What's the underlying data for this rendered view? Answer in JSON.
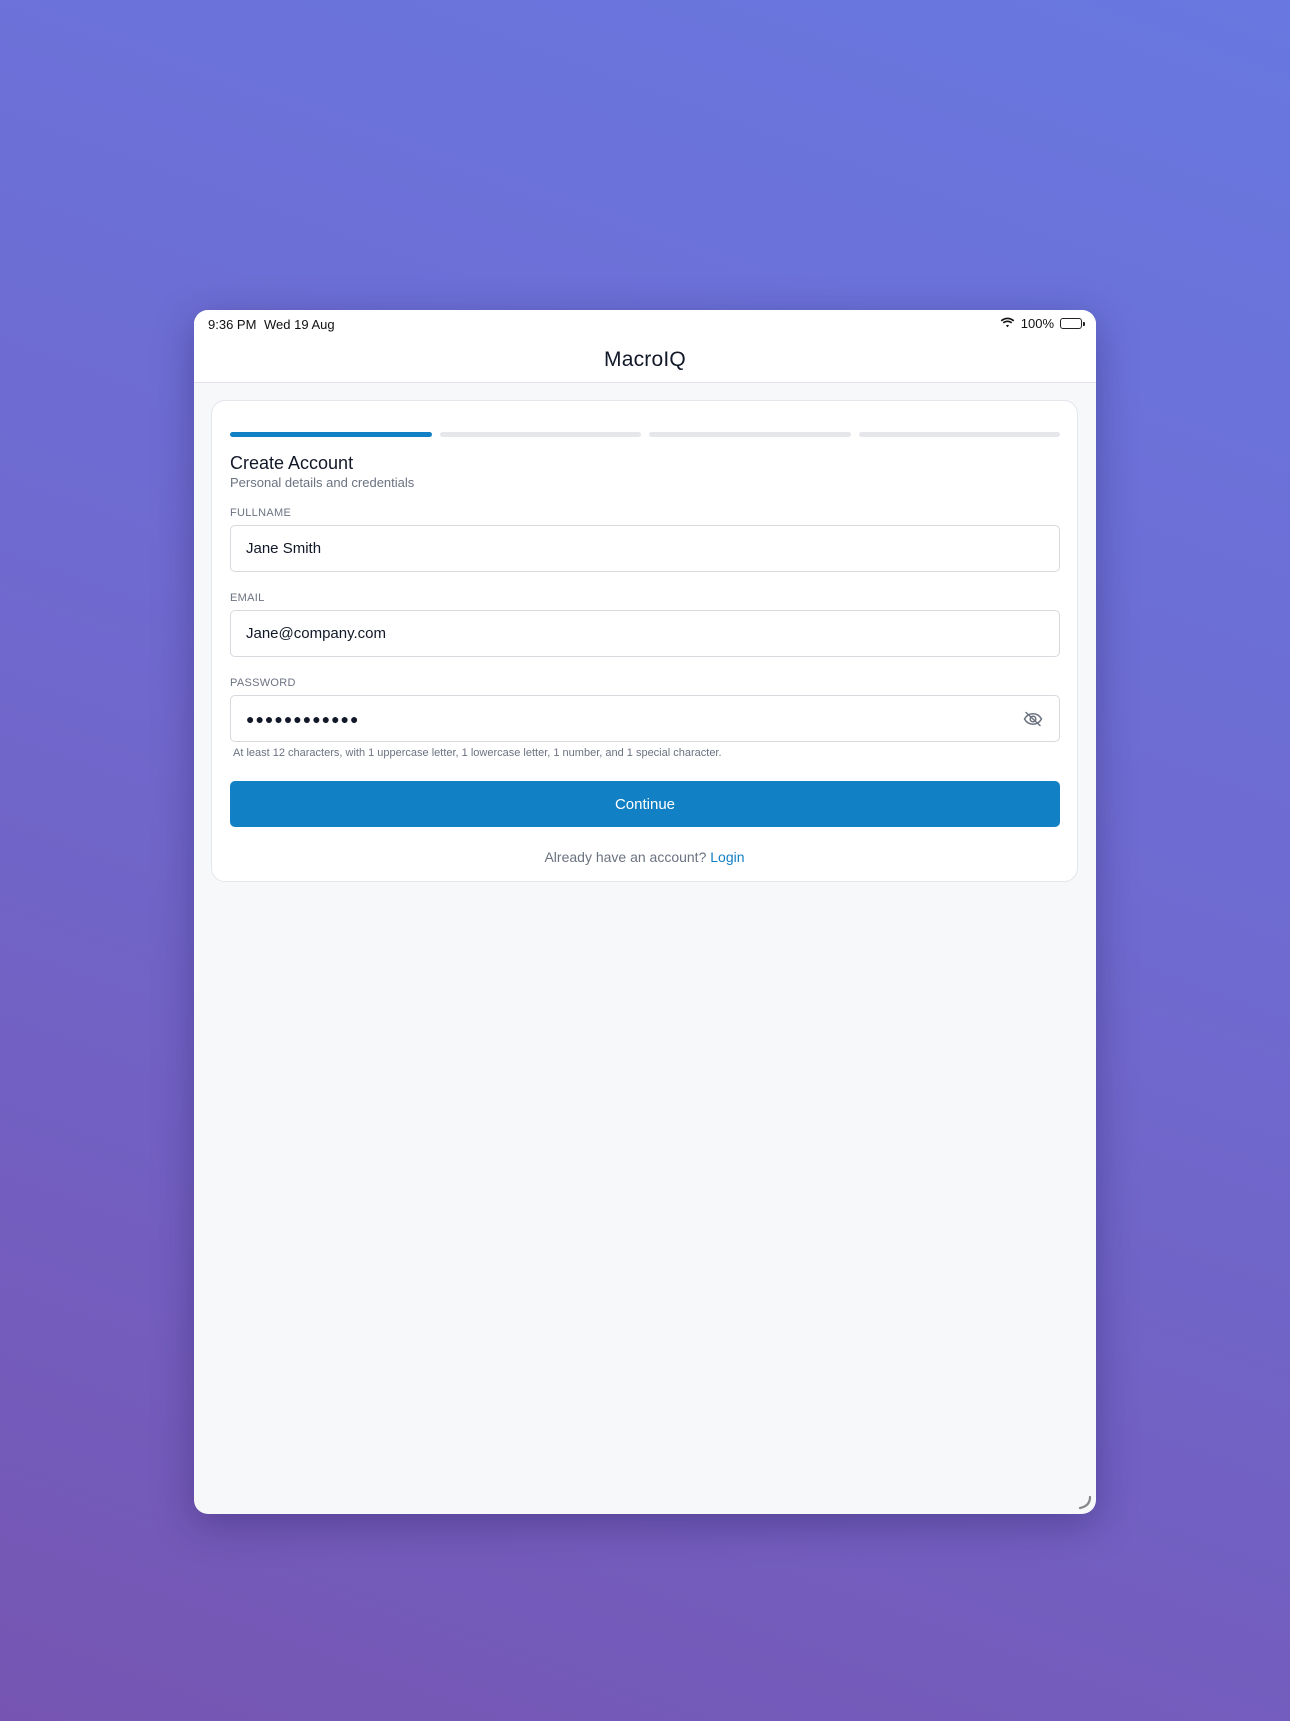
{
  "status_bar": {
    "time": "9:36 PM",
    "date": "Wed 19 Aug",
    "battery": "100%",
    "icons": [
      "wifi-icon",
      "battery-icon"
    ]
  },
  "navbar": {
    "title": "MacroIQ"
  },
  "progress": {
    "total_steps": 4,
    "current_step": 1
  },
  "form": {
    "title": "Create Account",
    "subtitle": "Personal details and credentials",
    "fullname": {
      "label": "FULLNAME",
      "value": "Jane Smith"
    },
    "email": {
      "label": "EMAIL",
      "value": "Jane@company.com"
    },
    "password": {
      "label": "PASSWORD",
      "value": "●●●●●●●●●●●●",
      "toggle_icon": "eye-off-icon",
      "hint": "At least 12 characters, with 1 uppercase letter, 1 lowercase letter, 1 number, and 1 special character."
    },
    "continue_label": "Continue",
    "login_prompt": "Already have an account?",
    "login_link": "Login"
  },
  "colors": {
    "accent": "#1280c4",
    "muted_text": "#6b7280",
    "track": "#e5e7eb"
  }
}
